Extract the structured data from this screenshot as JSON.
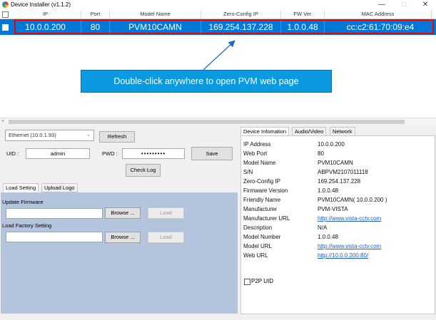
{
  "window": {
    "title": "Device Installer (v1.1.2)",
    "min_glyph": "—",
    "max_glyph": "□",
    "close_glyph": "✕"
  },
  "table": {
    "columns": [
      "IP",
      "Port",
      "Model Name",
      "Zero-Config IP",
      "FW Ver",
      "MAC Address"
    ],
    "selected_row": [
      "10.0.0.200",
      "80",
      "PVM10CAMN",
      "169.254.137.228",
      "1.0.0.48",
      "cc:c2:61:70:09:e4"
    ]
  },
  "callout": {
    "text": "Double-click anywhere to open PVM web page"
  },
  "scroll_left_glyph": "<",
  "controls": {
    "nic_value": "Ethernet (10.0.1.93)",
    "nic_caret": "⌄",
    "refresh_label": "Refresh",
    "uid_label": "UID :",
    "uid_value": "admin",
    "pwd_label": "PWD :",
    "pwd_value": "•••••••••",
    "save_label": "Save",
    "checklog_label": "Check Log"
  },
  "left_tabs": [
    "Load Setting",
    "Upload Logo"
  ],
  "load_panel": {
    "update_firmware_label": "Update Firmware",
    "factory_label": "Load Factory Setting",
    "browse_label": "Browse ...",
    "load_label": "Load"
  },
  "right_tabs": [
    "Device Infomation",
    "Audio/Video",
    "Network"
  ],
  "device_info": [
    {
      "label": "IP Address",
      "value": "10.0.0.200"
    },
    {
      "label": "Web Port",
      "value": "80"
    },
    {
      "label": "Model Name",
      "value": "PVM10CAMN"
    },
    {
      "label": "S/N",
      "value": "ABPVM2107011118"
    },
    {
      "label": "Zero-Config IP",
      "value": "169.254.137.228"
    },
    {
      "label": "Firmware Version",
      "value": "1.0.0.48"
    },
    {
      "label": "Friendly Name",
      "value": "PVM10CAMN( 10.0.0.200 )"
    },
    {
      "label": "Manufacturer",
      "value": "PVM-VISTA"
    },
    {
      "label": "Manufacturer URL",
      "value": "http://www.vista-cctv.com"
    },
    {
      "label": "Description",
      "value": "N/A"
    },
    {
      "label": "Model Number",
      "value": "1.0.0.48"
    },
    {
      "label": "Model URL",
      "value": "http://www.vista-cctv.com"
    },
    {
      "label": "Web URL",
      "value": "http://10.0.0.200:80/"
    }
  ],
  "p2p_label": "P2P UID",
  "colors": {
    "selection": "#0078d7",
    "highlight_border": "#e00000",
    "callout": "#0b9ae0",
    "link": "#1a5fd0",
    "load_panel": "#b4c4dc"
  }
}
